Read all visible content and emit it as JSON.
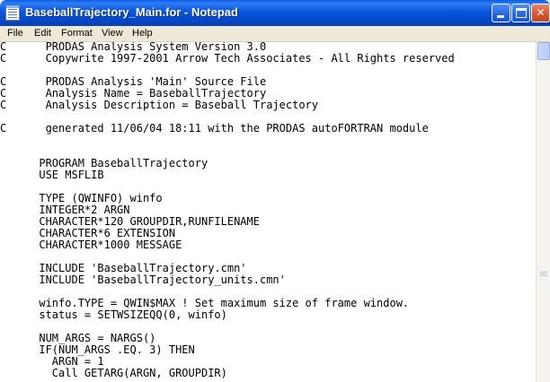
{
  "window": {
    "title": "BaseballTrajectory_Main.for - Notepad",
    "buttons": {
      "minimize": "minimize-icon",
      "maximize": "maximize-icon",
      "close": "✕"
    }
  },
  "menu": {
    "items": [
      "File",
      "Edit",
      "Format",
      "View",
      "Help"
    ]
  },
  "editor": {
    "lines": [
      "C      PRODAS Analysis System Version 3.0",
      "C      Copywrite 1997-2001 Arrow Tech Associates - All Rights reserved",
      "",
      "C      PRODAS Analysis 'Main' Source File",
      "C      Analysis Name = BaseballTrajectory",
      "C      Analysis Description = Baseball Trajectory",
      "",
      "C      generated 11/06/04 18:11 with the PRODAS autoFORTRAN module",
      "",
      "",
      "      PROGRAM BaseballTrajectory",
      "      USE MSFLIB",
      "",
      "      TYPE (QWINFO) winfo",
      "      INTEGER*2 ARGN",
      "      CHARACTER*120 GROUPDIR,RUNFILENAME",
      "      CHARACTER*6 EXTENSION",
      "      CHARACTER*1000 MESSAGE",
      "",
      "      INCLUDE 'BaseballTrajectory.cmn'",
      "      INCLUDE 'BaseballTrajectory_units.cmn'",
      "",
      "      winfo.TYPE = QWIN$MAX ! Set maximum size of frame window.",
      "      status = SETWSIZEQQ(0, winfo)",
      "",
      "      NUM_ARGS = NARGS()",
      "      IF(NUM_ARGS .EQ. 3) THEN",
      "        ARGN = 1",
      "        Call GETARG(ARGN, GROUPDIR)"
    ]
  },
  "colors": {
    "titlebar": "#0a56db",
    "menubar": "#ece9d8",
    "editor_bg": "#ffffff",
    "text": "#000000"
  }
}
